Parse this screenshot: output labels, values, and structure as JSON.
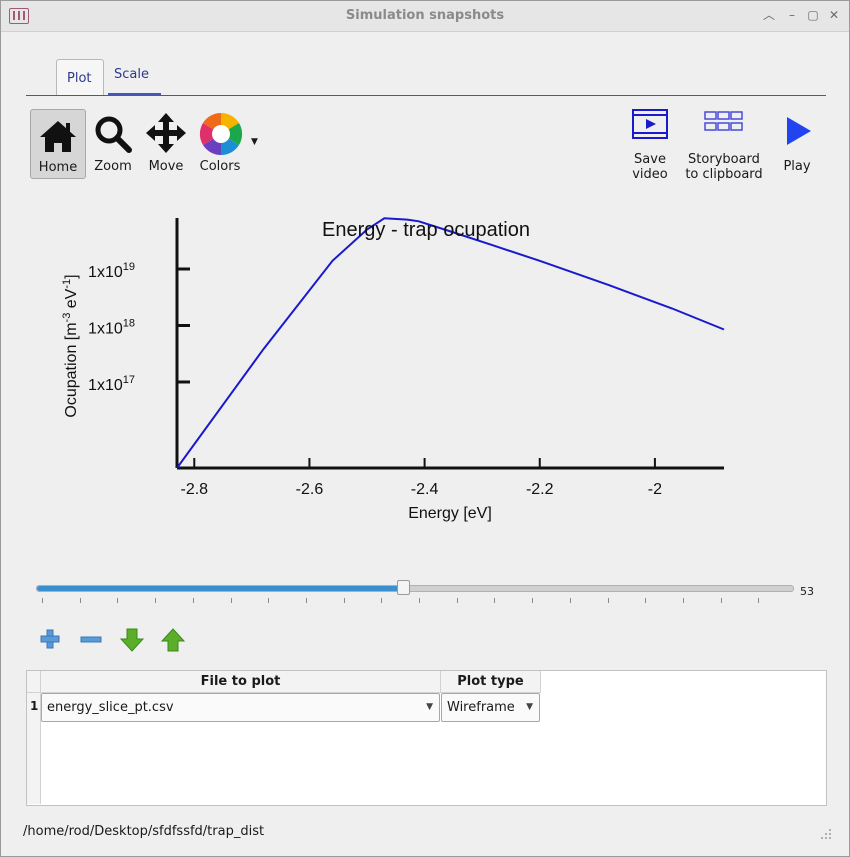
{
  "window": {
    "title": "Simulation snapshots"
  },
  "tabs": [
    {
      "label": "Plot"
    },
    {
      "label": "Scale"
    }
  ],
  "toolbar": {
    "home_label": "Home",
    "zoom_label": "Zoom",
    "move_label": "Move",
    "colors_label": "Colors",
    "save_video_line1": "Save",
    "save_video_line2": "video",
    "storyboard_line1": "Storyboard",
    "storyboard_line2": "to clipboard",
    "play_label": "Play"
  },
  "chart_data": {
    "type": "line",
    "title": "Energy - trap ocupation",
    "xlabel": "Energy [eV]",
    "ylabel": "Ocupation [m-3 eV-1]",
    "y_scale": "log",
    "xlim": [
      -2.83,
      -1.88
    ],
    "ylim": [
      3000000000000000.0,
      8e+19
    ],
    "x_ticks": [
      "-2.8",
      "-2.6",
      "-2.4",
      "-2.2",
      "-2"
    ],
    "y_ticks": [
      {
        "base": "1x10",
        "exp": "19"
      },
      {
        "base": "1x10",
        "exp": "18"
      },
      {
        "base": "1x10",
        "exp": "17"
      }
    ],
    "grid": false,
    "series": [
      {
        "color": "#1a1acc",
        "x": [
          -2.83,
          -2.68,
          -2.56,
          -2.5,
          -2.47,
          -2.43,
          -2.41,
          -2.36,
          -2.28,
          -2.2,
          -2.08,
          -1.97,
          -1.88
        ],
        "y": [
          3000000000000000.0,
          3.8e+17,
          1.4e+19,
          5e+19,
          7.9e+19,
          7.5e+19,
          7e+19,
          4.8e+19,
          2.6e+19,
          1.4e+19,
          5.2e+18,
          2e+18,
          8.5e+17
        ]
      }
    ]
  },
  "slider": {
    "value": "53",
    "fraction": 0.484
  },
  "table": {
    "headers": [
      "File to plot",
      "Plot type"
    ],
    "rows": [
      {
        "num": "1",
        "file": "energy_slice_pt.csv",
        "plot_type": "Wireframe"
      }
    ]
  },
  "status": {
    "path": "/home/rod/Desktop/sfdfssfd/trap_dist"
  },
  "colors": {
    "accent": "#3a8fd0",
    "series": "#1a1acc",
    "tab_text": "#2d3a8c"
  }
}
